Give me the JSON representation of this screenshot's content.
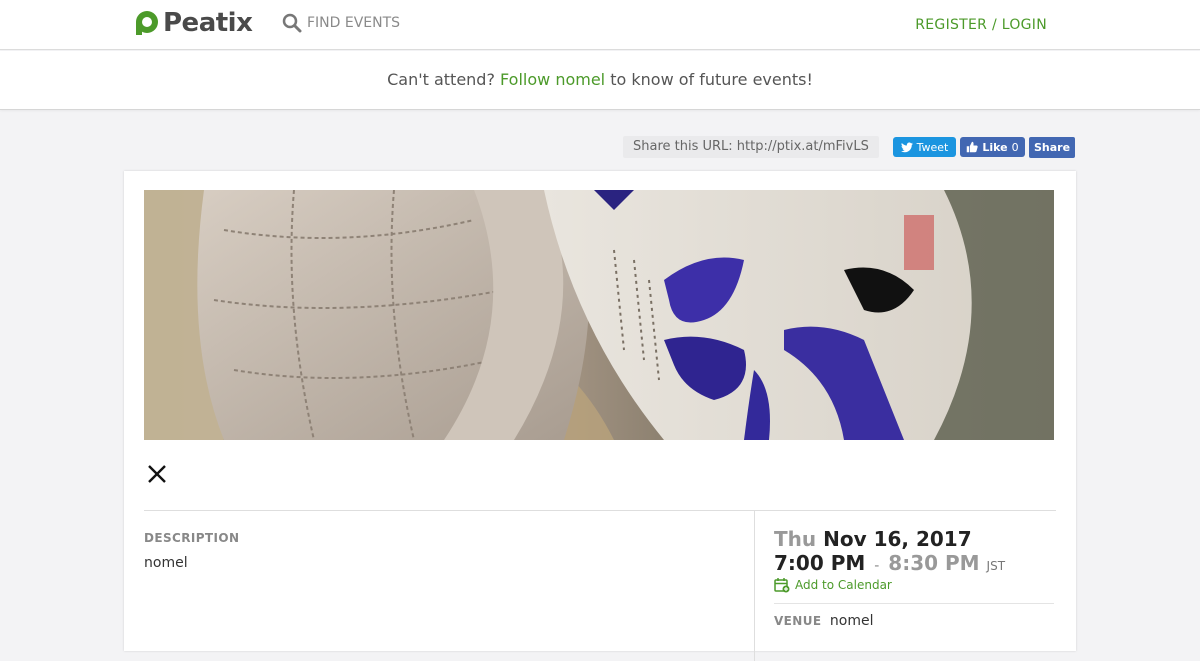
{
  "header": {
    "logo_text": "Peatix",
    "find_events_label": "FIND EVENTS",
    "register_login_label": "REGISTER / LOGIN",
    "brand_color": "#4c9a2a"
  },
  "follow_banner": {
    "prefix": "Can't attend?",
    "link_text": "Follow nomel",
    "suffix": "to know of future events!"
  },
  "share": {
    "url_text": "Share this URL: http://ptix.at/mFivLS",
    "tweet_label": "Tweet",
    "like_label": "Like",
    "like_count": "0",
    "share_label": "Share"
  },
  "event": {
    "description_label": "DESCRIPTION",
    "description_text": "nomel",
    "day_of_week": "Thu",
    "date": "Nov 16, 2017",
    "start_time": "7:00 PM",
    "separator": "-",
    "end_time": "8:30 PM",
    "timezone": "JST",
    "add_to_calendar_label": "Add to Calendar",
    "venue_label": "VENUE",
    "venue_name": "nomel"
  },
  "icons": {
    "logo": "peatix-logo-icon",
    "search": "search-icon",
    "twitter": "twitter-bird-icon",
    "like": "thumbs-up-icon",
    "close": "close-icon",
    "calendar": "calendar-add-icon"
  }
}
